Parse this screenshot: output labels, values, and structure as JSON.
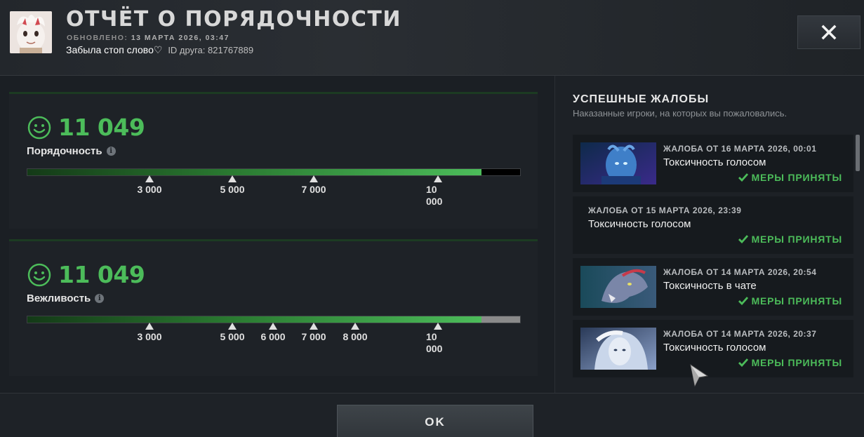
{
  "header": {
    "title": "ОТЧЁТ О ПОРЯДОЧНОСТИ",
    "updated_label": "ОБНОВЛЕНО:",
    "updated_time": "13 МАРТА 2026, 03:47",
    "nickname": "Забыла стоп слово♡",
    "friend_id": "ID друга: 821767889",
    "close_icon": "close-icon"
  },
  "metrics": [
    {
      "score": "11 049",
      "label": "Порядочность",
      "icon": "smiley-icon",
      "fill_fraction": 0.921,
      "track_color": "#000000",
      "ticks": [
        "3 000",
        "5 000",
        "7 000",
        "10 000"
      ]
    },
    {
      "score": "11 049",
      "label": "Вежливость",
      "icon": "smiley-icon",
      "fill_fraction": 0.921,
      "track_color": "#8a8a8a",
      "ticks": [
        "3 000",
        "5 000",
        "6 000",
        "7 000",
        "8 000",
        "10 000"
      ]
    }
  ],
  "reports": {
    "title": "УСПЕШНЫЕ ЖАЛОБЫ",
    "subtitle": "Наказанные игроки, на которых вы пожаловались.",
    "items": [
      {
        "date": "ЖАЛОБА ОТ 16 МАРТА 2026, 00:01",
        "reason": "Токсичность голосом",
        "status": "МЕРЫ ПРИНЯТЫ",
        "has_portrait": true
      },
      {
        "date": "ЖАЛОБА ОТ 15 МАРТА 2026, 23:39",
        "reason": "Токсичность голосом",
        "status": "МЕРЫ ПРИНЯТЫ",
        "has_portrait": false
      },
      {
        "date": "ЖАЛОБА ОТ 14 МАРТА 2026, 20:54",
        "reason": "Токсичность в чате",
        "status": "МЕРЫ ПРИНЯТЫ",
        "has_portrait": true
      },
      {
        "date": "ЖАЛОБА ОТ 14 МАРТА 2026, 20:37",
        "reason": "Токсичность голосом",
        "status": "МЕРЫ ПРИНЯТЫ",
        "has_portrait": true
      }
    ]
  },
  "footer": {
    "ok_label": "OK"
  },
  "colors": {
    "accent_green": "#4cbc5a",
    "background": "#1b1f24"
  }
}
